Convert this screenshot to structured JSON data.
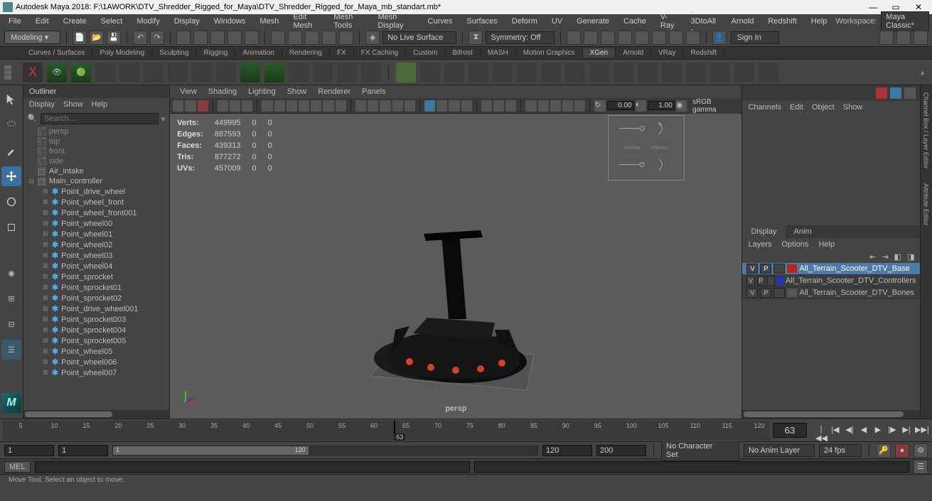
{
  "title": "Autodesk Maya 2018: F:\\1AWORK\\DTV_Shredder_Rigged_for_Maya\\DTV_Shredder_Rigged_for_Maya_mb_standart.mb*",
  "menubar": [
    "File",
    "Edit",
    "Create",
    "Select",
    "Modify",
    "Display",
    "Windows",
    "Mesh",
    "Edit Mesh",
    "Mesh Tools",
    "Mesh Display",
    "Curves",
    "Surfaces",
    "Deform",
    "UV",
    "Generate",
    "Cache",
    "V-Ray",
    "- 3DtoAll -",
    "Arnold",
    "Redshift",
    "Help"
  ],
  "workspace_label": "Workspace:",
  "workspace_value": "Maya Classic*",
  "module_set": "Modeling",
  "no_live": "No Live Surface",
  "symmetry": "Symmetry: Off",
  "signin": "Sign In",
  "shelf_tabs": [
    "Curves / Surfaces",
    "Poly Modeling",
    "Sculpting",
    "Rigging",
    "Animation",
    "Rendering",
    "FX",
    "FX Caching",
    "Custom",
    "Bifrost",
    "MASH",
    "Motion Graphics",
    "XGen",
    "Arnold",
    "VRay",
    "Redshift"
  ],
  "shelf_active": "XGen",
  "outliner": {
    "title": "Outliner",
    "menu": [
      "Display",
      "Show",
      "Help"
    ],
    "search_ph": "Search...",
    "nodes_top": [
      {
        "t": "persp",
        "dim": true,
        "icon": "cam"
      },
      {
        "t": "top",
        "dim": true,
        "icon": "cam"
      },
      {
        "t": "front",
        "dim": true,
        "icon": "cam"
      },
      {
        "t": "side",
        "dim": true,
        "icon": "cam"
      },
      {
        "t": "Air_intake",
        "dim": false,
        "icon": "grp"
      }
    ],
    "main": "Main_controller",
    "children": [
      "Point_drive_wheel",
      "Point_wheel_front",
      "Point_wheel_front001",
      "Point_wheel00",
      "Point_wheel01",
      "Point_wheel02",
      "Point_wheel03",
      "Point_wheel04",
      "Point_sprocket",
      "Point_sprocket01",
      "Point_sprocket02",
      "Point_drive_wheel001",
      "Point_sprocket003",
      "Point_sprocket004",
      "Point_sprocket005",
      "Point_wheel05",
      "Point_wheel006",
      "Point_wheel007"
    ]
  },
  "viewport": {
    "menu": [
      "View",
      "Shading",
      "Lighting",
      "Show",
      "Renderer",
      "Panels"
    ],
    "hud": {
      "rows": [
        {
          "l": "Verts:",
          "a": "449995",
          "b": "0",
          "c": "0"
        },
        {
          "l": "Edges:",
          "a": "887593",
          "b": "0",
          "c": "0"
        },
        {
          "l": "Faces:",
          "a": "439313",
          "b": "0",
          "c": "0"
        },
        {
          "l": "Tris:",
          "a": "877272",
          "b": "0",
          "c": "0"
        },
        {
          "l": "UVs:",
          "a": "457009",
          "b": "0",
          "c": "0"
        }
      ]
    },
    "camera": "persp",
    "field0": "0.00",
    "field1": "1.00",
    "gamma": "sRGB gamma"
  },
  "channel": {
    "menu": [
      "Channels",
      "Edit",
      "Object",
      "Show"
    ],
    "layer_tabs": [
      "Display",
      "Anim"
    ],
    "layer_tab_active": "Display",
    "layer_menu": [
      "Layers",
      "Options",
      "Help"
    ],
    "layers": [
      {
        "v": "V",
        "p": "P",
        "t": "",
        "color": "#bb2222",
        "name": "All_Terrain_Scooter_DTV_Base",
        "sel": true
      },
      {
        "v": "V",
        "p": "P",
        "t": "",
        "color": "#2233cc",
        "name": "All_Terrain_Scooter_DTV_Controllers",
        "sel": false
      },
      {
        "v": "V",
        "p": "P",
        "t": "",
        "color": "#555",
        "name": "All_Terrain_Scooter_DTV_Bones",
        "sel": false
      }
    ]
  },
  "side_tabs": [
    "Channel Box / Layer Editor",
    "Attribute Editor"
  ],
  "time": {
    "current": "63",
    "ticks": [
      "5",
      "10",
      "15",
      "20",
      "25",
      "30",
      "35",
      "40",
      "45",
      "50",
      "55",
      "60",
      "65",
      "70",
      "75",
      "80",
      "85",
      "90",
      "95",
      "100",
      "105",
      "110",
      "115",
      "120"
    ],
    "current_pos_pct": 51
  },
  "range": {
    "start_outer": "1",
    "start_inner": "1",
    "end_inner_label": "120",
    "end_inner": "120",
    "end_outer": "200",
    "charset": "No Character Set",
    "animlayer": "No Anim Layer",
    "fps": "24 fps"
  },
  "cmd_label": "MEL",
  "helpline": "Move Tool: Select an object to move."
}
